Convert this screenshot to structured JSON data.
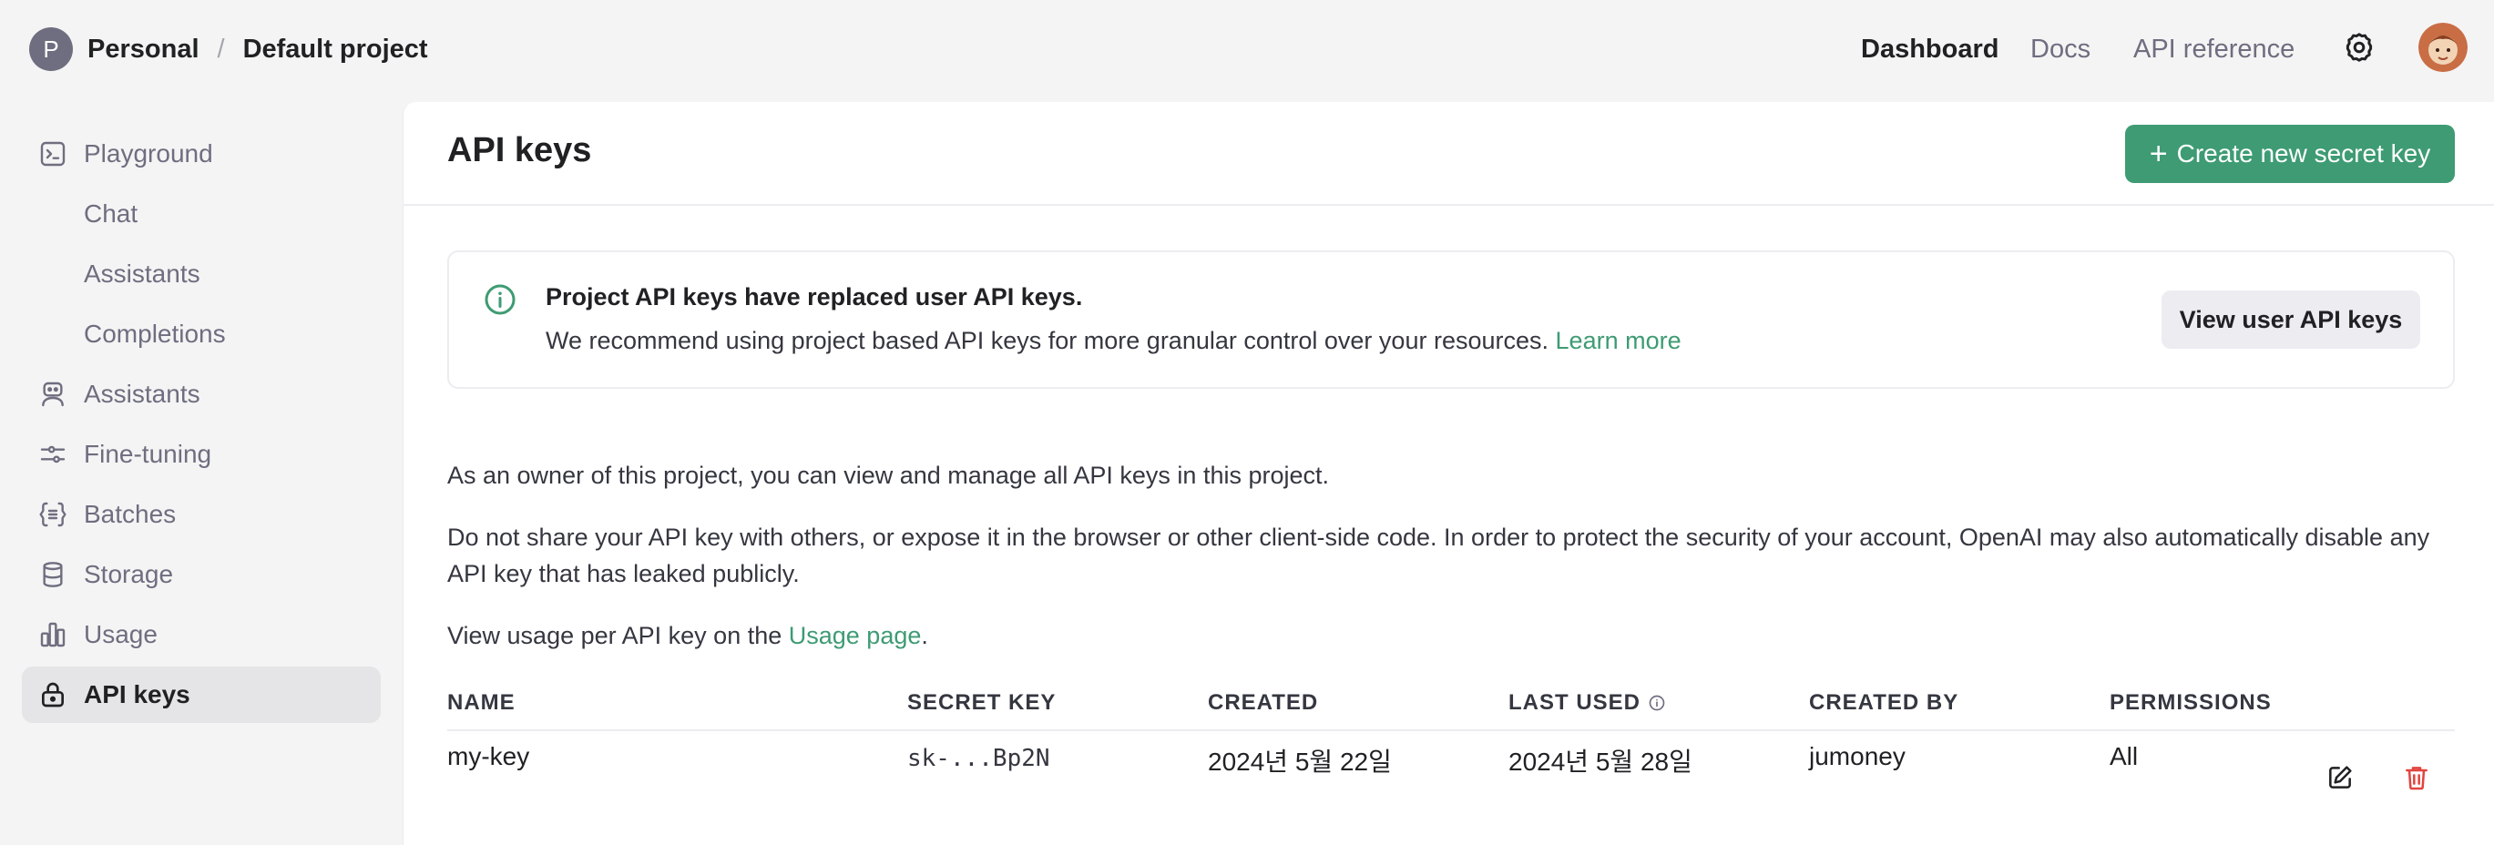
{
  "topbar": {
    "org_initial": "P",
    "org_name": "Personal",
    "separator": "/",
    "project_name": "Default project",
    "nav": {
      "dashboard": "Dashboard",
      "docs": "Docs",
      "api_reference": "API reference"
    },
    "settings_icon": "gear-icon",
    "user_avatar_icon": "avatar-image"
  },
  "sidebar": {
    "items": [
      {
        "label": "Playground",
        "icon": "terminal-icon"
      },
      {
        "label": "Chat",
        "icon": ""
      },
      {
        "label": "Assistants",
        "icon": ""
      },
      {
        "label": "Completions",
        "icon": ""
      },
      {
        "label": "Assistants",
        "icon": "robot-icon"
      },
      {
        "label": "Fine-tuning",
        "icon": "sliders-icon"
      },
      {
        "label": "Batches",
        "icon": "braces-list-icon"
      },
      {
        "label": "Storage",
        "icon": "database-icon"
      },
      {
        "label": "Usage",
        "icon": "bar-chart-icon"
      },
      {
        "label": "API keys",
        "icon": "lock-icon",
        "active": true
      }
    ]
  },
  "main": {
    "title": "API keys",
    "create_button": "Create new secret key",
    "notice": {
      "title": "Project API keys have replaced user API keys.",
      "body": "We recommend using project based API keys for more granular control over your resources.",
      "link": "Learn more",
      "button": "View user API keys"
    },
    "para1": "As an owner of this project, you can view and manage all API keys in this project.",
    "para2": "Do not share your API key with others, or expose it in the browser or other client-side code. In order to protect the security of your account, OpenAI may also automatically disable any API key that has leaked publicly.",
    "para3_prefix": "View usage per API key on the ",
    "para3_link": "Usage page",
    "para3_suffix": ".",
    "table": {
      "headers": [
        "NAME",
        "SECRET KEY",
        "CREATED",
        "LAST USED",
        "CREATED BY",
        "PERMISSIONS"
      ],
      "rows": [
        {
          "name": "my-key",
          "secret_key": "sk-...Bp2N",
          "created": "2024년 5월 22일",
          "last_used": "2024년 5월 28일",
          "created_by": "jumoney",
          "permissions": "All"
        }
      ]
    }
  },
  "colors": {
    "accent_green": "#3e9b73",
    "delete_red": "#e0453f",
    "sidebar_bg": "#f4f4f4",
    "active_item_bg": "#e5e5e8"
  }
}
